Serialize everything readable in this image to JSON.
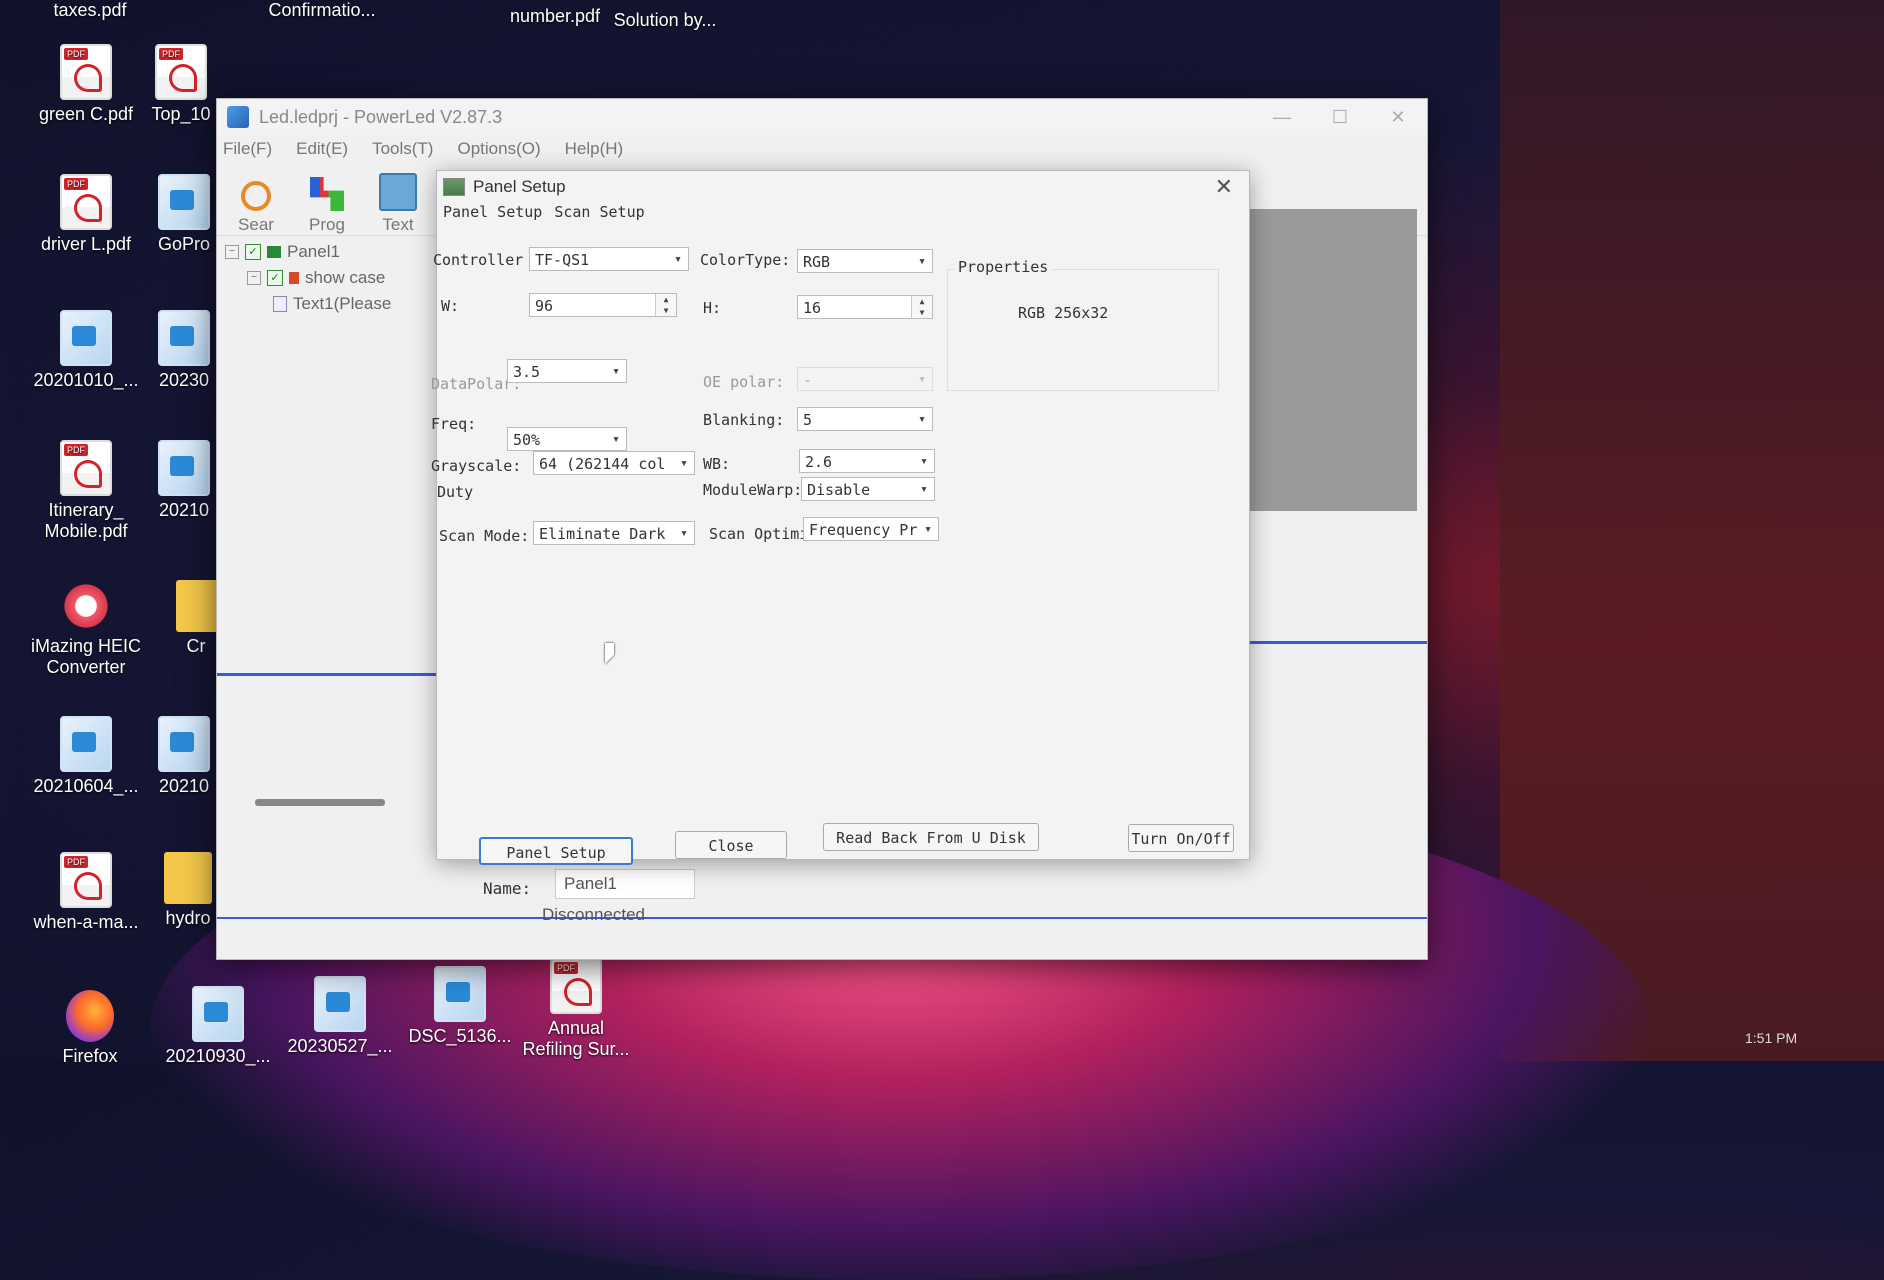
{
  "desktop": {
    "icons": [
      {
        "label": "taxes.pdf",
        "type": "pdf"
      },
      {
        "label": "Confirmatio...",
        "type": "pdf"
      },
      {
        "label": "number.pdf",
        "type": "pdf"
      },
      {
        "label": "Solution by...",
        "type": "pdf"
      },
      {
        "label": "green C.pdf",
        "type": "pdf"
      },
      {
        "label": "Top_10",
        "type": "pdf"
      },
      {
        "label": "driver L.pdf",
        "type": "pdf"
      },
      {
        "label": "GoPro",
        "type": "img"
      },
      {
        "label": "20201010_...",
        "type": "img"
      },
      {
        "label": "20230",
        "type": "img"
      },
      {
        "label": "Itinerary_ Mobile.pdf",
        "type": "pdf"
      },
      {
        "label": "20210",
        "type": "img"
      },
      {
        "label": "iMazing HEIC Converter",
        "type": "heic"
      },
      {
        "label": "Cr",
        "type": "folder"
      },
      {
        "label": "20210604_...",
        "type": "img"
      },
      {
        "label": "20210",
        "type": "img"
      },
      {
        "label": "when-a-ma...",
        "type": "pdf"
      },
      {
        "label": "hydro",
        "type": "folder"
      },
      {
        "label": "Firefox",
        "type": "firefox"
      },
      {
        "label": "20210930_...",
        "type": "img"
      },
      {
        "label": "20230527_...",
        "type": "img"
      },
      {
        "label": "DSC_5136...",
        "type": "img"
      },
      {
        "label": "Annual Refiling Sur...",
        "type": "pdf"
      }
    ],
    "clock": "1:51 PM"
  },
  "app": {
    "title": "Led.ledprj - PowerLed V2.87.3",
    "window_controls": [
      "—",
      "☐",
      "✕"
    ],
    "menu": [
      "File(F)",
      "Edit(E)",
      "Tools(T)",
      "Options(O)",
      "Help(H)"
    ],
    "toolbar": [
      {
        "label": "Sear",
        "icon": "search-icon"
      },
      {
        "label": "Prog",
        "icon": "program-icon"
      },
      {
        "label": "Text",
        "icon": "text-icon"
      }
    ],
    "tree": {
      "panel": "Panel1",
      "program": "show case",
      "text_item": "Text1(Please"
    },
    "name_label": "Name:",
    "name_value": "Panel1",
    "status": "Disconnected"
  },
  "dialog": {
    "title": "Panel Setup",
    "tabs": [
      "Panel Setup",
      "Scan Setup"
    ],
    "fields": {
      "controller": {
        "label": "Controller",
        "value": "TF-QS1"
      },
      "colortype": {
        "label": "ColorType:",
        "value": "RGB"
      },
      "w": {
        "label": "W:",
        "value": "96"
      },
      "h": {
        "label": "H:",
        "value": "16"
      },
      "datapolar": {
        "label": "DataPolar:",
        "value": "3.5"
      },
      "oe_polar": {
        "label": "OE polar:",
        "value": "-"
      },
      "freq": {
        "label": "Freq:",
        "value": "50%"
      },
      "blanking": {
        "label": "Blanking:",
        "value": "5"
      },
      "grayscale": {
        "label": "Grayscale:",
        "value": "64 (262144 col"
      },
      "wb": {
        "label": "WB:",
        "value": "2.6"
      },
      "duty": {
        "label": "Duty"
      },
      "modulewarp": {
        "label": "ModuleWarp:",
        "value": "Disable"
      },
      "scan_mode": {
        "label": "Scan Mode:",
        "value": "Eliminate Dark"
      },
      "scan_optimize": {
        "label": "Scan Optimi",
        "value": "Frequency Pr"
      }
    },
    "properties": {
      "title": "Properties",
      "value": "RGB 256x32"
    },
    "buttons": {
      "panel_setup": "Panel Setup",
      "close": "Close",
      "read_back": "Read Back From U Disk",
      "turn_on_off": "Turn On/Off"
    }
  }
}
